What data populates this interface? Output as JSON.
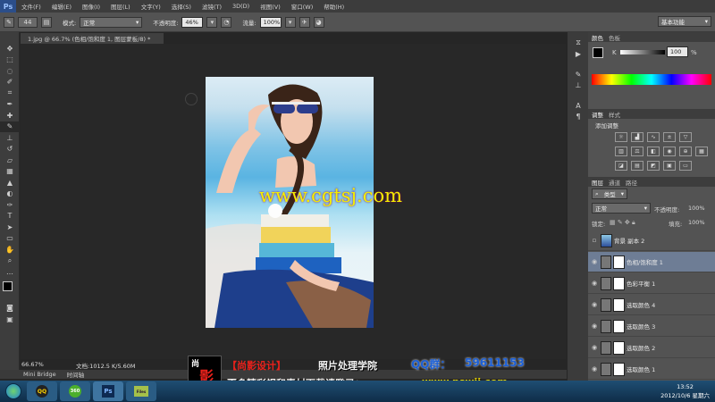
{
  "menubar": {
    "logo": "Ps",
    "items": [
      "文件(F)",
      "编辑(E)",
      "图像(I)",
      "图层(L)",
      "文字(Y)",
      "选择(S)",
      "滤镜(T)",
      "3D(D)",
      "视图(V)",
      "窗口(W)",
      "帮助(H)"
    ]
  },
  "options": {
    "brush_size": "44",
    "mode_label": "模式:",
    "mode_value": "正常",
    "opacity_label": "不透明度:",
    "opacity_value": "46%",
    "flow_label": "流量:",
    "flow_value": "100%",
    "workspace": "基本功能"
  },
  "document": {
    "tab": "1.jpg @ 66.7% (色相/饱和度 1, 图层蒙板/8) *",
    "zoom": "66.67%",
    "doc_info": "文档:1012.5 K/5.60M"
  },
  "watermark": "www.cgtsj.com",
  "panels": {
    "color_tabs": [
      "颜色",
      "色板"
    ],
    "color_k_label": "K",
    "color_k_value": "100",
    "color_k_unit": "%",
    "adjust_tabs": [
      "调整",
      "样式"
    ],
    "adjust_title": "添加调整",
    "layers_tabs": [
      "图层",
      "通道",
      "路径"
    ],
    "filter_kind": "类型",
    "blend_mode": "正常",
    "opacity_label": "不透明度:",
    "opacity_value": "100%",
    "lock_label": "锁定:",
    "fill_label": "填充:",
    "fill_value": "100%",
    "layers": [
      {
        "name": "背景 副本 2",
        "visible": false
      },
      {
        "name": "色相/饱和度 1",
        "visible": true
      },
      {
        "name": "色彩平衡 1",
        "visible": true
      },
      {
        "name": "选取颜色 4",
        "visible": true
      },
      {
        "name": "选取颜色 3",
        "visible": true
      },
      {
        "name": "选取颜色 2",
        "visible": true
      },
      {
        "name": "选取颜色 1",
        "visible": true
      }
    ]
  },
  "mini_bridge": {
    "tabs": [
      "Mini Bridge",
      "时间轴"
    ]
  },
  "banner": {
    "logo_top": "尚",
    "logo_mid": "影",
    "logo_bottom": "设计",
    "brand": "【尚影设计】",
    "school": "照片处理学院",
    "qq_label": "QQ群：",
    "qq_number": "59611153",
    "slogan": "更多精彩视和素材下载请登录：",
    "site": "www.pswjj.com"
  },
  "taskbar": {
    "time": "13:52",
    "date": "2012/10/6 星期六",
    "apps": [
      "QQ",
      "360",
      "Ps",
      "Files"
    ]
  },
  "colors": {
    "accent": "#2b4e8a",
    "banner_red": "#e8211b",
    "banner_blue": "#1b5fd6",
    "watermark": "#f4f000"
  }
}
